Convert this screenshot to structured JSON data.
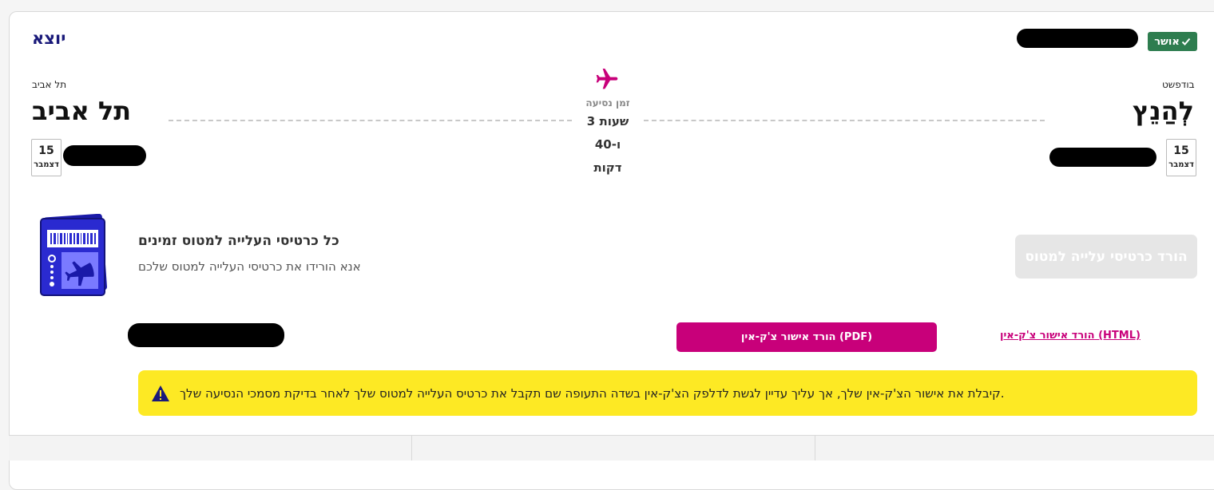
{
  "header": {
    "direction_label": "יוצא",
    "status_badge": "אושר",
    "status_icon": "check-icon"
  },
  "flight": {
    "origin": {
      "small_name": "בודפשט",
      "big_name": "לְהַנֵץ",
      "date_day": "15",
      "date_month": "דצמבר"
    },
    "destination": {
      "small_name": "תל אביב",
      "big_name": "תל אביב",
      "date_day": "15",
      "date_month": "דצמבר"
    },
    "duration_label": "זמן נסיעה",
    "duration_lines": [
      "3 שעות",
      "ו-40",
      "דקות"
    ],
    "plane_icon": "airplane-icon"
  },
  "boarding": {
    "title": "כל כרטיסי העלייה למטוס זמינים",
    "subtitle": "אנא הורידו את כרטיסי העלייה למטוס שלכם",
    "download_button": "הורד כרטיסי עלייה למטוס",
    "icon": "boarding-pass-icon"
  },
  "checkin": {
    "pdf_button": "הורד אישור צ'ק-אין (PDF)",
    "html_link": "הורד אישור צ'ק-אין (HTML)"
  },
  "alert": {
    "text": "קיבלת את אישור הצ'ק-אין שלך, אך עליך עדיין לגשת לדלפק הצ'ק-אין בשדה התעופה שם תקבל את כרטיס העלייה למטוס שלך לאחר בדיקת מסמכי הנסיעה שלך.",
    "icon": "warning-icon"
  },
  "colors": {
    "accent": "#c8007a",
    "brand_navy": "#1a1a7a",
    "success": "#2e7d4f",
    "alert_bg": "#fde924"
  }
}
